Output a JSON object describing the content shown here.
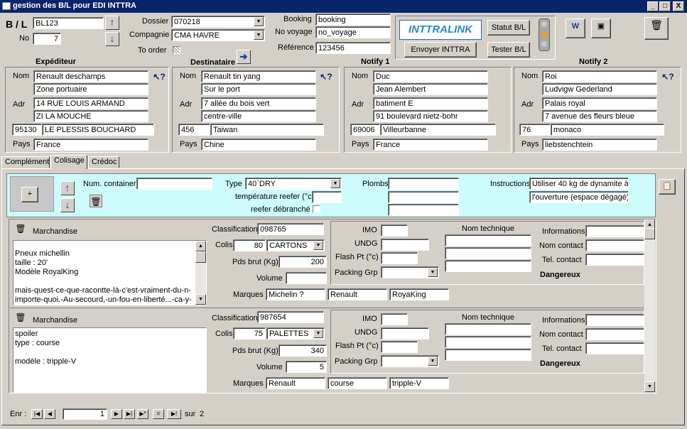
{
  "window": {
    "title": "gestion des B/L pour EDI INTTRA",
    "min": "_",
    "max": "□",
    "close": "X"
  },
  "header": {
    "bl_label": "B / L",
    "bl_value": "BL123",
    "no_label": "No",
    "no_value": "7",
    "dossier_label": "Dossier",
    "dossier_value": "070218",
    "compagnie_label": "Compagnie",
    "compagnie_value": "CMA HAVRE",
    "to_order_label": "To order",
    "booking_label": "Booking",
    "booking_value": "booking",
    "voyage_label": "No voyage",
    "voyage_value": "no_voyage",
    "reference_label": "Référence",
    "reference_value": "123456",
    "logo_text": "INTTRALINK",
    "statut_btn": "Statut B/L",
    "envoyer_btn": "Envoyer INTTRA",
    "tester_btn": "Tester B/L"
  },
  "parties": [
    {
      "title": "Expéditeur",
      "nom": "Renault deschamps",
      "nom2": "Zone portuaire",
      "adr1": "14 RUE LOUIS ARMAND",
      "adr2": "ZI LA MOUCHE",
      "cp": "95130",
      "ville": "LE PLESSIS BOUCHARD",
      "pays": "France"
    },
    {
      "title": "Destinataire",
      "nom": "Renault tin yang",
      "nom2": "Sur le port",
      "adr1": "7 allée du bois vert",
      "adr2": "centre-ville",
      "cp": "456",
      "ville": "Taiwan",
      "pays": "Chine"
    },
    {
      "title": "Notify 1",
      "nom": "Duc",
      "nom2": "Jean Alembert",
      "adr1": "batiment E",
      "adr2": "91 boulevard nietz-bohr",
      "cp": "69006",
      "ville": "Villeurbanne",
      "pays": "France"
    },
    {
      "title": "Notify 2",
      "nom": "Roi",
      "nom2": "Ludvigw Gederland",
      "adr1": "Palais royal",
      "adr2": "7 avenue des fleurs bleue",
      "cp": "76",
      "ville": "monaco",
      "pays": "liebstenchtein"
    }
  ],
  "labels": {
    "nom": "Nom",
    "adr": "Adr",
    "pays": "Pays"
  },
  "tabs": [
    "Complément",
    "Colisage",
    "Crédoc"
  ],
  "container": {
    "num_label": "Num. container",
    "num_value": "",
    "type_label": "Type",
    "type_value": "40`DRY",
    "temp_label": "température reefer (°c)",
    "temp_value": "",
    "debranche_label": "reefer débranché",
    "plombs_label": "Plombs",
    "instr_label": "Instructions",
    "instr1": "Utiliser 40 kg de dynamite à",
    "instr2": "l'ouverture (espace dégagé)"
  },
  "goods": [
    {
      "marchandise_label": "Marchandise",
      "text": [
        "Pneux michellin",
        "taille : 20'",
        "Modèle   RoyalKing",
        "",
        "mais-quest-ce-que-racontte-là-c'est-vraiment-du-n-",
        "importe-quoi.-Au-secourd,-un-fou-en-liberté...-ca-y-"
      ],
      "classification": "098765",
      "colis": "80",
      "colis_type": "CARTONS",
      "pds": "200",
      "volume": "",
      "marques": [
        "Michelin ?",
        "Renault",
        "RoyaKing"
      ]
    },
    {
      "marchandise_label": "Marchandise",
      "text": [
        "spoiler",
        "type : course",
        "",
        "modèle : tripple-V"
      ],
      "classification": "987654",
      "colis": "75",
      "colis_type": "PALETTES",
      "pds": "340",
      "volume": "5",
      "marques": [
        "Renault",
        "course",
        "tripple-V"
      ]
    }
  ],
  "goods_labels": {
    "classification": "Classification",
    "colis": "Colis",
    "pds": "Pds brut (Kg)",
    "volume": "Volume",
    "marques": "Marques",
    "imo": "IMO",
    "undg": "UNDG",
    "flash": "Flash Pt (°c)",
    "packing": "Packing Grp",
    "nom_tech": "Nom technique",
    "infos": "Informations",
    "nom_contact": "Nom contact",
    "tel_contact": "Tel. contact",
    "dangereux": "Dangereux"
  },
  "nav": {
    "label": "Enr :",
    "current": "1",
    "total_label": "sur",
    "total": "2"
  }
}
